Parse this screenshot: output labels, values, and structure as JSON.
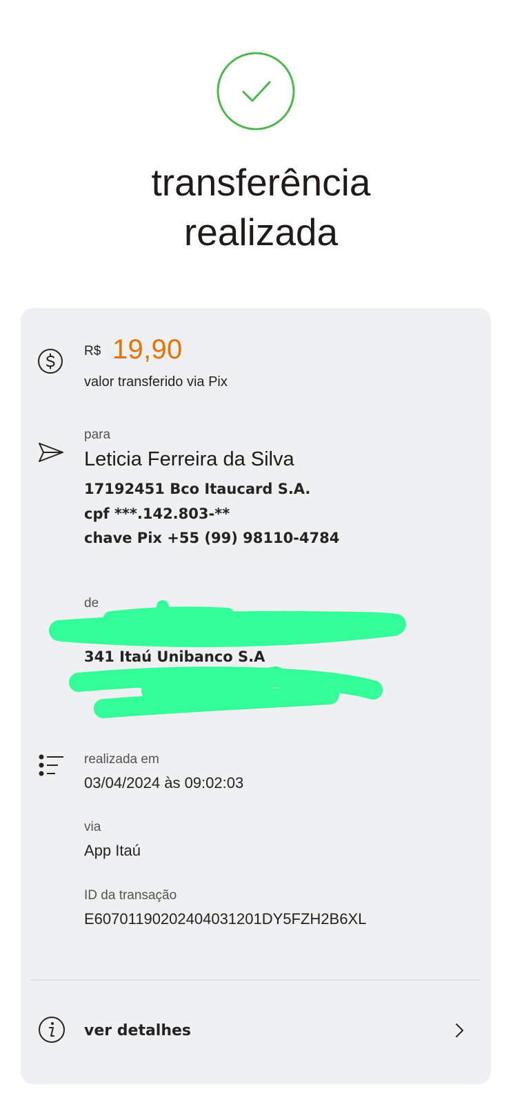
{
  "header": {
    "title_line1": "transferência",
    "title_line2": "realizada"
  },
  "colors": {
    "success": "#4ab84a",
    "amount": "#ec7000",
    "card_bg": "#eff0f2",
    "redaction": "#33fd99"
  },
  "icons": {
    "status": "check-circle-icon",
    "amount": "dollar-circle-icon",
    "recipient": "send-icon",
    "details_list": "list-icon",
    "info": "info-icon",
    "chevron": "chevron-right-icon"
  },
  "amount": {
    "currency": "R$",
    "value": "19,90",
    "caption": "valor transferido via Pix"
  },
  "recipient": {
    "label": "para",
    "name": "Leticia Ferreira da Silva",
    "bank": "17192451 Bco Itaucard S.A.",
    "cpf": "cpf ***.142.803-**",
    "pix_key": "chave Pix +55 (99) 98110-4784"
  },
  "sender": {
    "label": "de",
    "bank": "341 Itaú Unibanco S.A"
  },
  "transaction": {
    "date_label": "realizada em",
    "date_value": "03/04/2024 às 09:02:03",
    "via_label": "via",
    "via_value": "App Itaú",
    "id_label": "ID da transação",
    "id_value": "E60701190202404031201DY5FZH2B6XL"
  },
  "footer": {
    "details_label": "ver detalhes"
  }
}
